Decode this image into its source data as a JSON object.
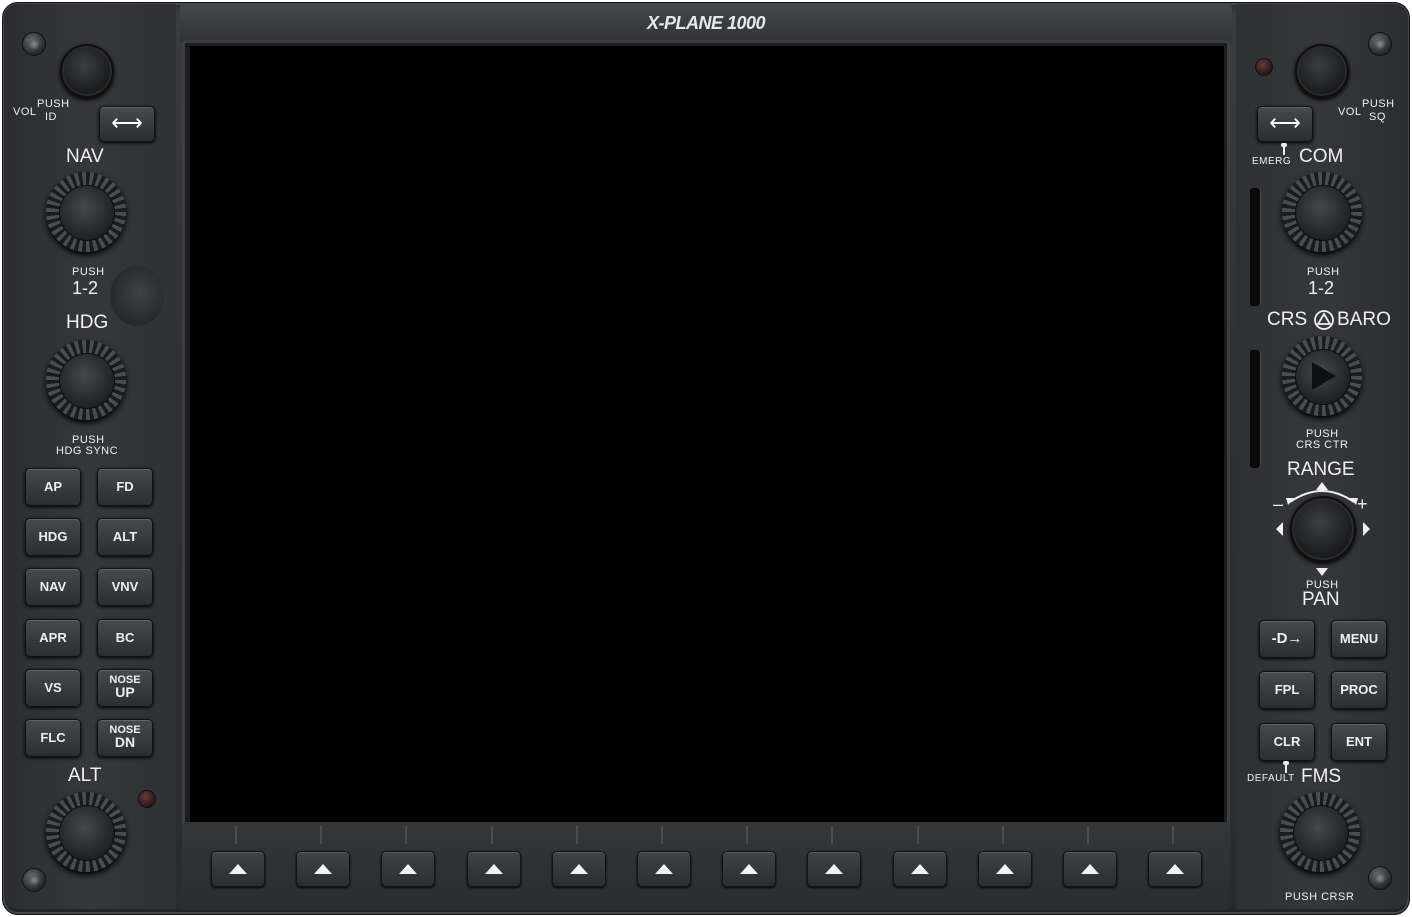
{
  "title": "X-PLANE 1000",
  "left_panel": {
    "vol_label": "VOL",
    "push_id_label_1": "PUSH",
    "push_id_label_2": "ID",
    "swap_glyph": "⟷",
    "nav_label": "NAV",
    "nav_push_label": "PUSH",
    "nav_push_value": "1-2",
    "hdg_label": "HDG",
    "hdg_push_label": "PUSH",
    "hdg_sync_label": "HDG SYNC",
    "buttons": [
      {
        "label": "AP"
      },
      {
        "label": "FD"
      },
      {
        "label": "HDG"
      },
      {
        "label": "ALT"
      },
      {
        "label": "NAV"
      },
      {
        "label": "VNV"
      },
      {
        "label": "APR"
      },
      {
        "label": "BC"
      },
      {
        "label": "VS"
      },
      {
        "top": "NOSE",
        "bottom": "UP"
      },
      {
        "label": "FLC"
      },
      {
        "top": "NOSE",
        "bottom": "DN"
      }
    ],
    "alt_label": "ALT"
  },
  "right_panel": {
    "vol_label": "VOL",
    "push_sq_label_1": "PUSH",
    "push_sq_label_2": "SQ",
    "swap_glyph": "⟷",
    "emerg_label": "EMERG",
    "com_label": "COM",
    "com_push_label": "PUSH",
    "com_push_value": "1-2",
    "crs_baro_label": "CRS-⚠-BARO",
    "crs_label": "CRS",
    "baro_label": "BARO",
    "crs_push_label": "PUSH",
    "crs_ctr_label": "CRS CTR",
    "range_label": "RANGE",
    "range_minus": "–",
    "range_plus": "+",
    "pan_push_label": "PUSH",
    "pan_label": "PAN",
    "buttons": [
      {
        "label": "-D→"
      },
      {
        "label": "MENU"
      },
      {
        "label": "FPL"
      },
      {
        "label": "PROC"
      },
      {
        "label": "CLR"
      },
      {
        "label": "ENT"
      }
    ],
    "default_label": "DEFAULT",
    "fms_label": "FMS",
    "push_crsr_label": "PUSH CRSR"
  },
  "softkeys": {
    "count": 12,
    "glyph": "up-triangle-icon"
  },
  "colors": {
    "bezel": "#2e3033",
    "screen": "#000000",
    "label": "#f0f0f0"
  }
}
